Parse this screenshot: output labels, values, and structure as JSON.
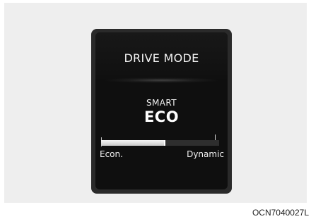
{
  "screen": {
    "title": "DRIVE MODE",
    "mode_sub": "SMART",
    "mode_main": "ECO"
  },
  "gauge": {
    "left_label": "Econ.",
    "right_label": "Dynamic",
    "level_fraction": 0.54
  },
  "caption": "OCN7040027L",
  "colors": {
    "screen_background": "#0f0f0f",
    "frame": "#2a2a2a",
    "text": "#f2f2f2",
    "panel_background": "#eeeeee"
  }
}
